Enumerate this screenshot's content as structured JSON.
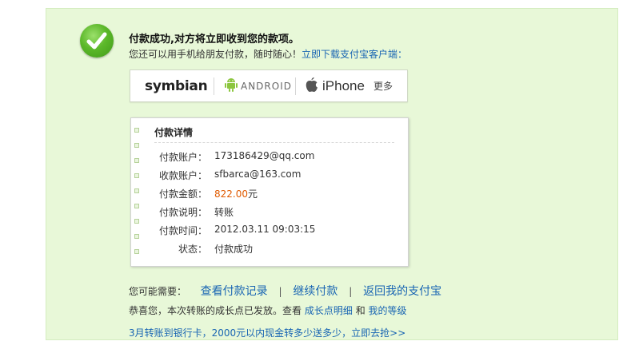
{
  "header": {
    "title": "付款成功,对方将立即收到您的款项。",
    "subtitle_text": "您还可以用手机给朋友付款，随时随心！",
    "subtitle_link": "立即下载支付宝客户端："
  },
  "platforms": {
    "symbian": "symbian",
    "android": "ANDROID",
    "iphone": "iPhone",
    "more": "更多"
  },
  "details": {
    "title": "付款详情",
    "rows": [
      {
        "label": "付款账户：",
        "value": "173186429@qq.com"
      },
      {
        "label": "收款账户：",
        "value": "sfbarca@163.com"
      },
      {
        "label": "付款金额：",
        "amount": "822.00",
        "unit": "元"
      },
      {
        "label": "付款说明：",
        "value": "转账"
      },
      {
        "label": "付款时间：",
        "value": "2012.03.11 09:03:15"
      },
      {
        "label": "状态：",
        "value": "付款成功"
      }
    ]
  },
  "actions": {
    "prefix": "您可能需要：",
    "items": [
      "查看付款记录",
      "继续付款",
      "返回我的支付宝"
    ],
    "separator": "|"
  },
  "growth": {
    "text": "恭喜您，本次转账的成长点已发放。查看",
    "link1": "成长点明细",
    "and": "和",
    "link2": "我的等级"
  },
  "promo": {
    "text": "3月转账到银行卡，2000元以内现金转多少送多少，立即去抢>>"
  },
  "colors": {
    "panel_bg": "#e8f8d8",
    "link": "#1a66b3",
    "amount": "#e05a00",
    "success_green": "#5cb82a"
  }
}
